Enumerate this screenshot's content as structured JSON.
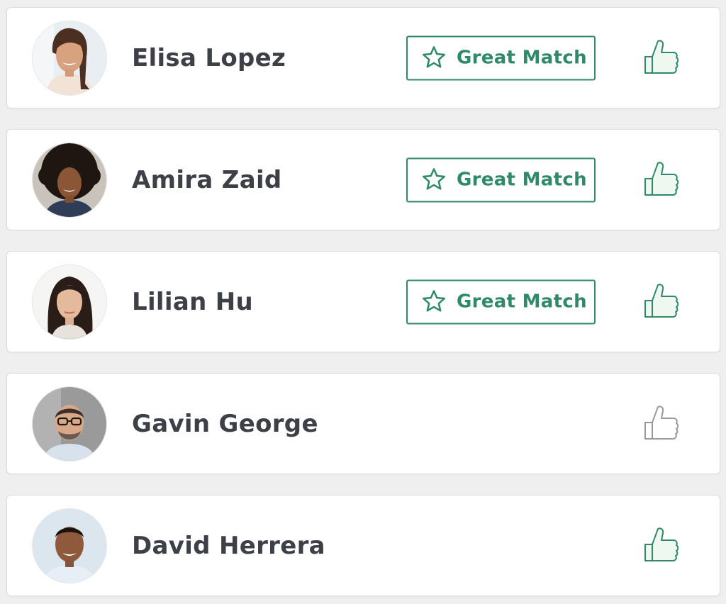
{
  "colors": {
    "accent": "#2f8a6a",
    "thumb_active_fill": "#eef8f1",
    "thumb_active_stroke": "#2f8a6a",
    "thumb_inactive_stroke": "#9a9a9a",
    "name_text": "#3d4147"
  },
  "people": [
    {
      "name": "Elisa Lopez",
      "badge": "Great Match",
      "liked": true
    },
    {
      "name": "Amira Zaid",
      "badge": "Great Match",
      "liked": true
    },
    {
      "name": "Lilian Hu",
      "badge": "Great Match",
      "liked": true
    },
    {
      "name": "Gavin George",
      "badge": "",
      "liked": false
    },
    {
      "name": "David Herrera",
      "badge": "",
      "liked": true
    }
  ],
  "icons": {
    "badge_icon": "star-icon",
    "like_icon": "thumbs-up-icon"
  }
}
